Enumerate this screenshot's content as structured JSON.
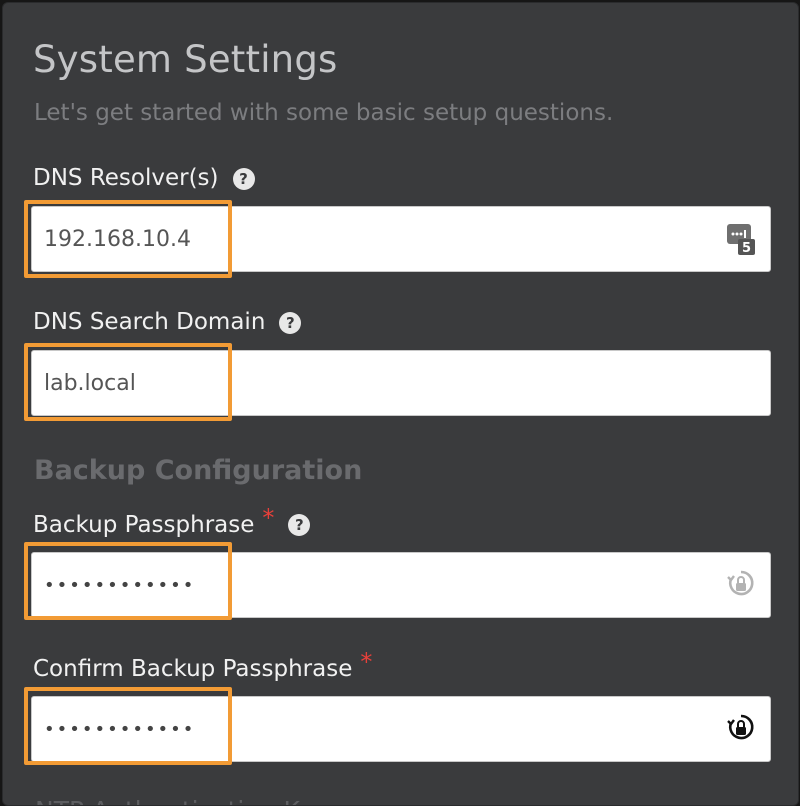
{
  "header": {
    "title": "System Settings",
    "subtitle": "Let's get started with some basic setup questions."
  },
  "dns_resolvers": {
    "label": "DNS Resolver(s)",
    "value": "192.168.10.4",
    "badge_count": "5"
  },
  "dns_search_domain": {
    "label": "DNS Search Domain",
    "value": "lab.local"
  },
  "backup_section": {
    "title": "Backup Configuration"
  },
  "backup_passphrase": {
    "label": "Backup Passphrase",
    "required_mark": "*",
    "value": "************"
  },
  "confirm_backup_passphrase": {
    "label": "Confirm Backup Passphrase",
    "required_mark": "*",
    "value": "************"
  },
  "next_section": {
    "title": "NTP Authentication Key"
  },
  "help_glyph": "?",
  "colors": {
    "panel": "#3a3b3d",
    "highlight": "#f29b35",
    "required": "#e8403a"
  }
}
